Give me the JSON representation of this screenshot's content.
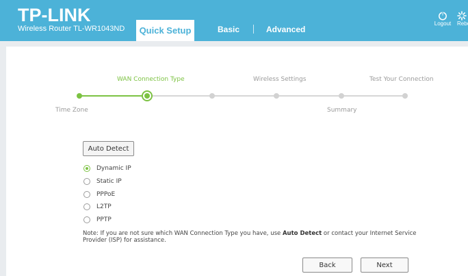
{
  "header": {
    "brand_name": "TP-LINK",
    "model": "Wireless Router TL-WR1043ND",
    "tabs": [
      {
        "label": "Quick Setup",
        "active": true
      },
      {
        "label": "Basic",
        "active": false
      },
      {
        "label": "Advanced",
        "active": false
      }
    ],
    "logout_label": "Logout",
    "logout_icon": "power-icon",
    "reboot_label": "Rebo",
    "reboot_icon": "reboot-icon",
    "bar_color": "#4cb2d8"
  },
  "stepper": {
    "accent_color": "#7cc242",
    "steps": [
      {
        "label": "Time Zone",
        "state": "done"
      },
      {
        "label": "WAN Connection Type",
        "state": "current"
      },
      {
        "label": "",
        "state": "todo"
      },
      {
        "label": "Wireless Settings",
        "state": "todo"
      },
      {
        "label": "",
        "state": "todo"
      },
      {
        "label": "Summary",
        "state": "todo"
      },
      {
        "label": "Test Your Connection",
        "state": "todo"
      }
    ]
  },
  "wan": {
    "auto_detect_label": "Auto Detect",
    "options": [
      {
        "label": "Dynamic IP",
        "selected": true
      },
      {
        "label": "Static IP",
        "selected": false
      },
      {
        "label": "PPPoE",
        "selected": false
      },
      {
        "label": "L2TP",
        "selected": false
      },
      {
        "label": "PPTP",
        "selected": false
      }
    ],
    "note_prefix": "Note: If you are not sure which WAN Connection Type you have, use ",
    "note_bold": "Auto Detect",
    "note_suffix": " or contact your Internet Service Provider (ISP) for assistance."
  },
  "footer": {
    "back_label": "Back",
    "next_label": "Next"
  }
}
